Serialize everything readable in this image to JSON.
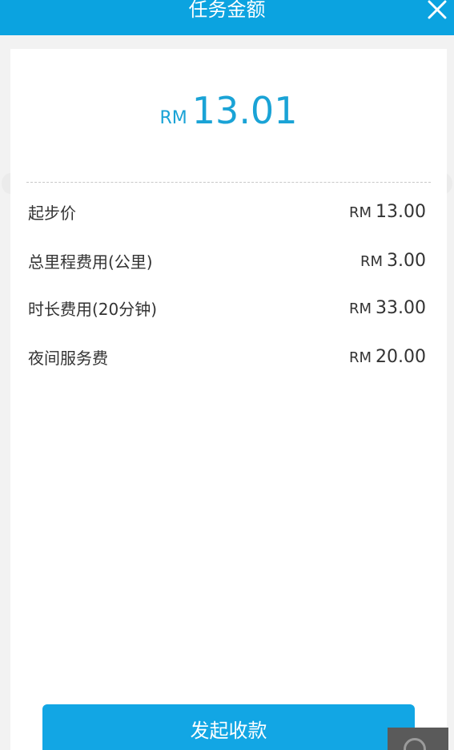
{
  "header": {
    "title": "任务金额"
  },
  "amount": {
    "currency": "RM",
    "value": "13.01"
  },
  "fees": [
    {
      "label": "起步价",
      "currency": "RM",
      "amount": "13.00"
    },
    {
      "label": "总里程费用(公里)",
      "currency": "RM",
      "amount": "3.00"
    },
    {
      "label": "时长费用(20分钟)",
      "currency": "RM",
      "amount": "33.00"
    },
    {
      "label": "夜间服务费",
      "currency": "RM",
      "amount": "20.00"
    }
  ],
  "actions": {
    "collect_label": "发起收款"
  },
  "colors": {
    "header_bg": "#0ba3e0",
    "accent": "#1aa3d6",
    "button_bg": "#12a6e4"
  },
  "icons": {
    "close": "close-icon",
    "overlay": "floating-assist-icon"
  }
}
